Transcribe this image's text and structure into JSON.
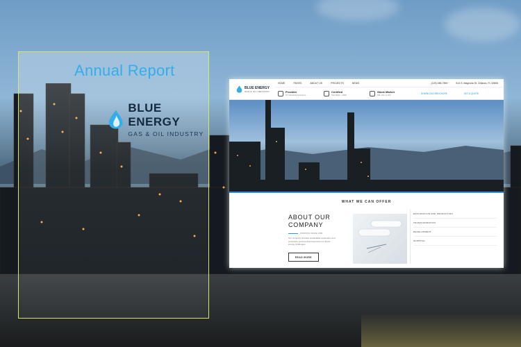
{
  "cover": {
    "title": "Annual Report",
    "brand_name": "BLUE ENERGY",
    "brand_sub": "GAS & OIL INDUSTRY"
  },
  "site": {
    "logo_name": "BLUE ENERGY",
    "logo_sub": "GAS & OIL INDUSTRY",
    "nav": [
      "HOME",
      "PAGES",
      "ABOUT US",
      "PROJECTS",
      "NEWS"
    ],
    "phone": "(123) 456-7890",
    "address": "514 S. Magnolia St. Orlando, FL 32806",
    "features": [
      {
        "title": "Provider",
        "sub": "Of Industrial Solutions"
      },
      {
        "title": "Certified",
        "sub": "ISO 9001 : 2008"
      },
      {
        "title": "Stock Market",
        "sub": "GB: 2% +1.5%"
      }
    ],
    "download_label": "DOWNLOAD BROCHURE",
    "quote_label": "GET A QUOTE",
    "offer_title": "WHAT WE CAN OFFER",
    "about_title_1": "ABOUT OUR",
    "about_title_2": "COMPANY",
    "about_since": "WORKING SINCE 1999",
    "about_text": "Our company provides sustainable exploration and production services that respond to our future energy challenges.",
    "about_button": "READ MORE",
    "offer_items": [
      "EXPLORATION AND PRODUCTION",
      "TRANSFORMATION",
      "DEVELOPMENT",
      "SHIPPING"
    ]
  },
  "colors": {
    "accent": "#33aee8",
    "cover_border": "#d8e86a",
    "link": "#2a9bd6"
  }
}
